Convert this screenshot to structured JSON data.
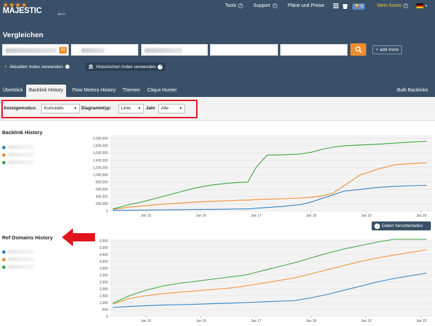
{
  "header": {
    "logo": "MAJESTIC",
    "logo_sub": "BETA",
    "nav": {
      "tools": "Tools",
      "support": "Support",
      "plans": "Pläne und Preise",
      "trophy_count": "5",
      "account": "Mein Konto"
    },
    "page_title": "Vergleichen",
    "add_more": "+ add more",
    "index_current": "Aktuellen Index verwenden",
    "index_historic": "Historischen Index verwenden"
  },
  "tabs": [
    {
      "label": "Überblick"
    },
    {
      "label": "Backlink History"
    },
    {
      "label": "Flow Metrics History"
    },
    {
      "label": "Themen"
    },
    {
      "label": "Clique Hunter"
    }
  ],
  "bulk_backlinks": "Bulk Backlinks",
  "filters": {
    "mode_label": "Anzeigemodus:",
    "mode_value": "Kumulativ",
    "type_label": "Diagrammtyp:",
    "type_value": "Linie",
    "year_label": "Jahr",
    "year_value": "Alle"
  },
  "download_label": "Daten herunterladen",
  "colors": {
    "blue": "#2f7fc1",
    "orange": "#f08c2d",
    "green": "#3aa43a",
    "header": "#3a5068"
  },
  "chart_data": [
    {
      "type": "line",
      "title": "Backlink History",
      "yticks": [
        "0",
        "200,000",
        "400,000",
        "600,000",
        "800,000",
        "1,000,000",
        "1,200,000",
        "1,400,000",
        "1,600,000",
        "1,800,000",
        "2,000,000"
      ],
      "xticks": [
        "Jan 15",
        "Jan 16",
        "Jan 17",
        "Jan 18",
        "Jan 19",
        "Jan 20"
      ],
      "ylim": [
        0,
        2100000
      ],
      "x": [
        2014.4,
        2014.7,
        2015.0,
        2015.3,
        2015.6,
        2015.9,
        2016.2,
        2016.5,
        2016.7,
        2016.85,
        2017.0,
        2017.2,
        2017.5,
        2017.8,
        2018.0,
        2018.2,
        2018.4,
        2018.6,
        2018.9,
        2019.2,
        2019.5,
        2019.8,
        2020.1
      ],
      "series": [
        {
          "values": [
            20000,
            25000,
            30000,
            35000,
            40000,
            45000,
            50000,
            55000,
            60000,
            60000,
            80000,
            100000,
            130000,
            180000,
            250000,
            350000,
            450000,
            550000,
            600000,
            650000,
            680000,
            700000,
            710000
          ]
        },
        {
          "values": [
            50000,
            110000,
            150000,
            190000,
            220000,
            250000,
            270000,
            285000,
            300000,
            300000,
            320000,
            330000,
            340000,
            360000,
            380000,
            420000,
            500000,
            700000,
            1000000,
            1150000,
            1270000,
            1310000,
            1330000
          ]
        },
        {
          "values": [
            60000,
            180000,
            280000,
            400000,
            520000,
            640000,
            720000,
            770000,
            790000,
            800000,
            1200000,
            1540000,
            1550000,
            1570000,
            1620000,
            1700000,
            1760000,
            1800000,
            1820000,
            1840000,
            1870000,
            1900000,
            1920000
          ]
        }
      ]
    },
    {
      "type": "line",
      "title": "Ref Domains History",
      "yticks": [
        "0",
        "500",
        "1,000",
        "1,500",
        "2,000",
        "2,500",
        "3,000",
        "3,500",
        "4,000",
        "4,500",
        "5,000",
        "5,500"
      ],
      "xticks": [
        "Jan 15",
        "Jan 16",
        "Jan 17",
        "Jan 18",
        "Jan 19",
        "Jan 20"
      ],
      "ylim": [
        0,
        5600
      ],
      "x": [
        2014.4,
        2014.7,
        2015.0,
        2015.3,
        2015.6,
        2015.9,
        2016.2,
        2016.5,
        2016.8,
        2017.1,
        2017.4,
        2017.7,
        2018.0,
        2018.3,
        2018.6,
        2018.9,
        2019.2,
        2019.5,
        2019.8,
        2020.1
      ],
      "series": [
        {
          "values": [
            650,
            720,
            780,
            820,
            850,
            880,
            920,
            960,
            1000,
            1050,
            1100,
            1150,
            1350,
            1600,
            1900,
            2200,
            2500,
            2750,
            2950,
            3150
          ]
        },
        {
          "values": [
            900,
            1300,
            1500,
            1650,
            1750,
            1850,
            1950,
            2050,
            2200,
            2400,
            2600,
            2800,
            3100,
            3400,
            3700,
            4000,
            4250,
            4450,
            4650,
            4850
          ]
        },
        {
          "values": [
            950,
            1500,
            1900,
            2200,
            2400,
            2550,
            2700,
            2850,
            3000,
            3300,
            3600,
            3900,
            4250,
            4600,
            4900,
            5150,
            5400,
            5600,
            5800,
            6000
          ]
        }
      ]
    }
  ]
}
